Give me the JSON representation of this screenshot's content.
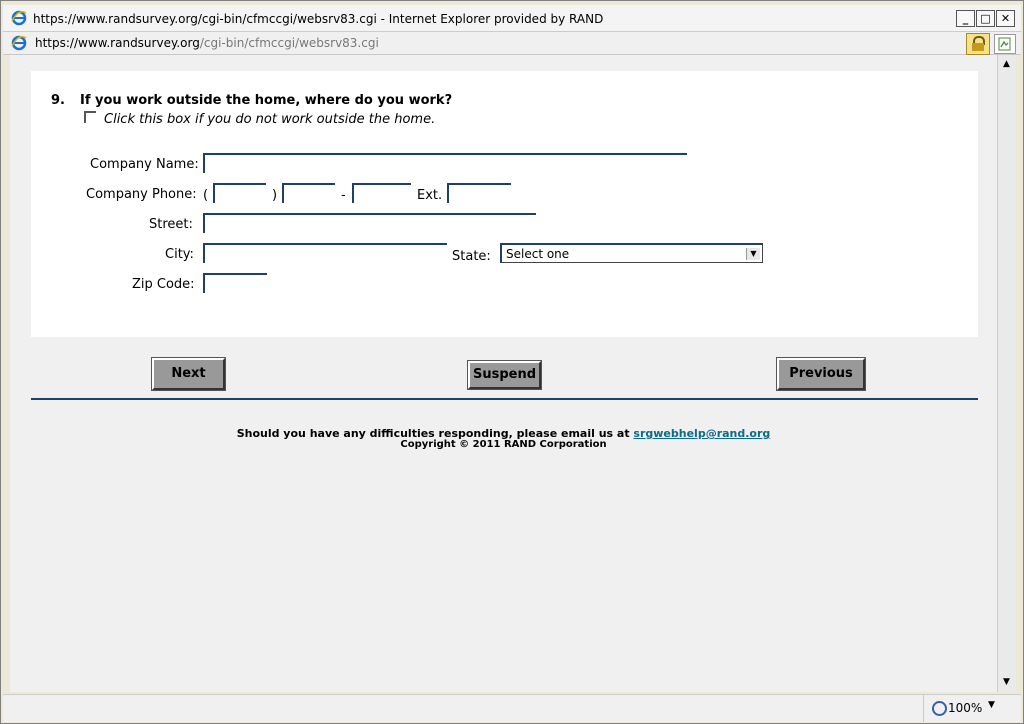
{
  "window": {
    "title": "https://www.randsurvey.org/cgi-bin/cfmccgi/websrv83.cgi - Internet Explorer provided by RAND",
    "minimize": "_",
    "maximize": "□",
    "close": "✕"
  },
  "address": {
    "url_host": "https://www.randsurvey.org",
    "url_path": "/cgi-bin/cfmccgi/websrv83.cgi"
  },
  "question": {
    "number": "9.",
    "text": "If you work outside the home, where do you work?",
    "checkbox_label": "Click this box if you do not work outside the home."
  },
  "form": {
    "company_name_label": "Company Name:",
    "company_phone_label": "Company Phone:",
    "open_paren": "(",
    "close_paren": ")",
    "dash": "-",
    "ext_label": "Ext.",
    "street_label": "Street:",
    "city_label": "City:",
    "state_label": "State:",
    "state_value": "Select one",
    "zip_label": "Zip Code:"
  },
  "buttons": {
    "next": "Next",
    "suspend": "Suspend",
    "previous": "Previous"
  },
  "footer": {
    "help_text": "Should you have any difficulties responding, please email us at ",
    "email": "srgwebhelp@rand.org",
    "copyright": "Copyright © 2011 RAND Corporation"
  },
  "status": {
    "zoom": "100%"
  },
  "colors": {
    "field_border": "#1f3f66",
    "link": "#0a6b8a",
    "button_face": "#999999"
  }
}
